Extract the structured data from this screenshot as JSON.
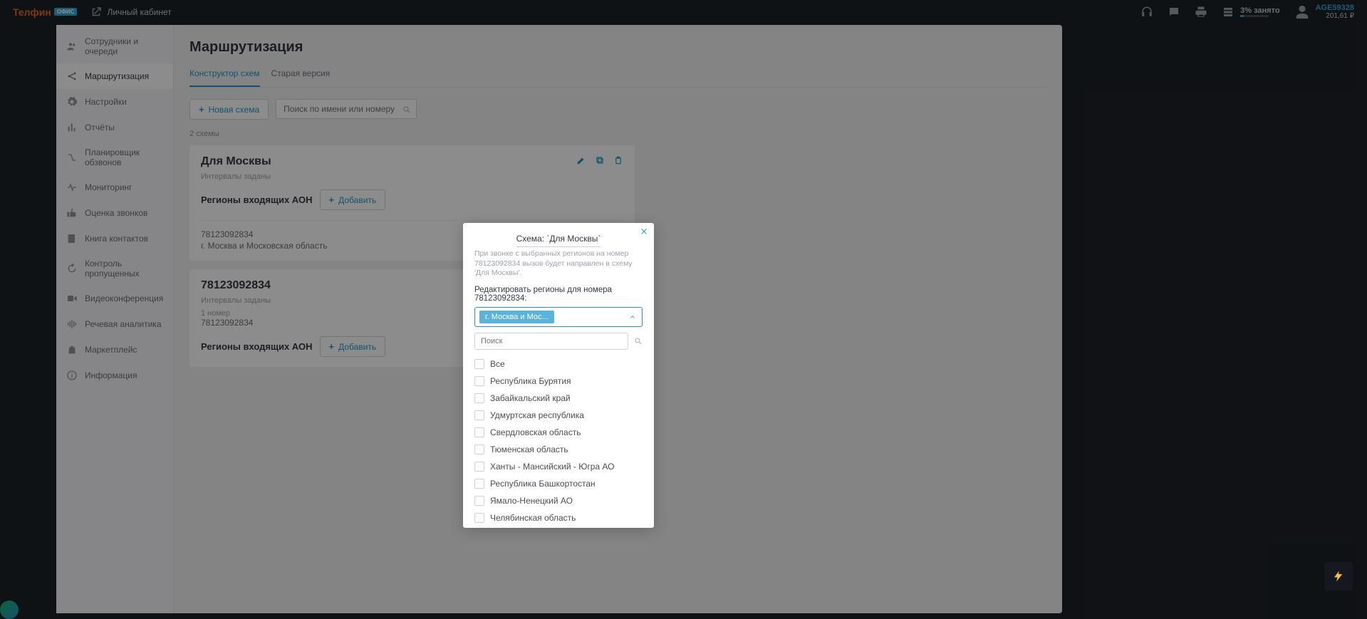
{
  "topbar": {
    "logo_main": "Телфин",
    "logo_badge": "ОФИС",
    "lk_label": "Личный кабинет",
    "usage_text": "3% занято",
    "user_name": "AGE59328",
    "user_balance": "201,61 ₽"
  },
  "sidebar": {
    "items": [
      {
        "label": "Сотрудники и очереди",
        "icon": "users"
      },
      {
        "label": "Маршрутизация",
        "icon": "share"
      },
      {
        "label": "Настройки",
        "icon": "gear"
      },
      {
        "label": "Отчёты",
        "icon": "bars"
      },
      {
        "label": "Планировщик обзвонов",
        "icon": "route"
      },
      {
        "label": "Мониторинг",
        "icon": "pulse"
      },
      {
        "label": "Оценка звонков",
        "icon": "thumb"
      },
      {
        "label": "Книга контактов",
        "icon": "book"
      },
      {
        "label": "Контроль пропущенных",
        "icon": "back"
      },
      {
        "label": "Видеоконференция",
        "icon": "video"
      },
      {
        "label": "Речевая аналитика",
        "icon": "wave"
      },
      {
        "label": "Маркетплейс",
        "icon": "bag"
      },
      {
        "label": "Информация",
        "icon": "info"
      }
    ]
  },
  "page": {
    "title": "Маршрутизация",
    "tabs": [
      "Конструктор схем",
      "Старая версия"
    ],
    "new_scheme_btn": "Новая схема",
    "search_placeholder": "Поиск по имени или номеру",
    "count_label": "2 схемы"
  },
  "schemes": [
    {
      "title": "Для Москвы",
      "intervals": "Интервалы заданы",
      "aon_label": "Регионы входящих АОН",
      "add_btn": "Добавить",
      "number": "78123092834",
      "region": "г. Москва и Московская область"
    },
    {
      "title": "78123092834",
      "intervals": "Интервалы заданы",
      "extra": "1 номер",
      "number": "78123092834",
      "aon_label": "Регионы входящих АОН",
      "add_btn": "Добавить"
    }
  ],
  "modal": {
    "title": "Схема: `Для Москвы`",
    "desc": "При звонке с выбранных регионов на номер 78123092834 вызов будет направлен в схему 'Для Москвы'.",
    "edit_label": "Редактировать регионы для номера 78123092834:",
    "chip": "г. Москва и Мос...",
    "search_placeholder": "Поиск",
    "options": [
      "Все",
      "Республика Бурятия",
      "Забайкальский край",
      "Удмуртская республика",
      "Свердловская область",
      "Тюменская область",
      "Ханты - Мансийский - Югра АО",
      "Республика Башкортостан",
      "Ямало-Ненецкий АО",
      "Челябинская область"
    ]
  }
}
